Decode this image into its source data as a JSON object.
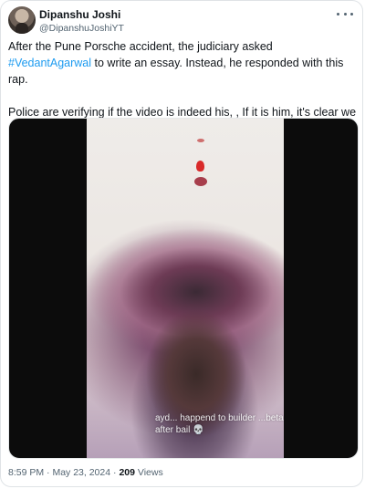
{
  "author": {
    "name": "Dipanshu Joshi",
    "handle": "@DipanshuJoshiYT"
  },
  "tweet": {
    "text_before_hashtag": "After the Pune Porsche accident, the judiciary asked ",
    "hashtag": "#VedantAgarwal",
    "text_after_hashtag": " to write an essay. Instead, he responded with this rap.",
    "paragraph2": "Police are verifying if the video is indeed his, , If it is him, it's clear we need some serious reforms in our judiciary system."
  },
  "media": {
    "caption": "ayd... happend to builder ...beta after bail 💀"
  },
  "meta": {
    "time": "8:59 PM",
    "separator": " · ",
    "date": "May 23, 2024",
    "views_count": "209",
    "views_label": " Views"
  },
  "colors": {
    "link": "#1d9bf0",
    "secondary_text": "#536471"
  },
  "icons": {
    "more": "more-dots-icon"
  }
}
